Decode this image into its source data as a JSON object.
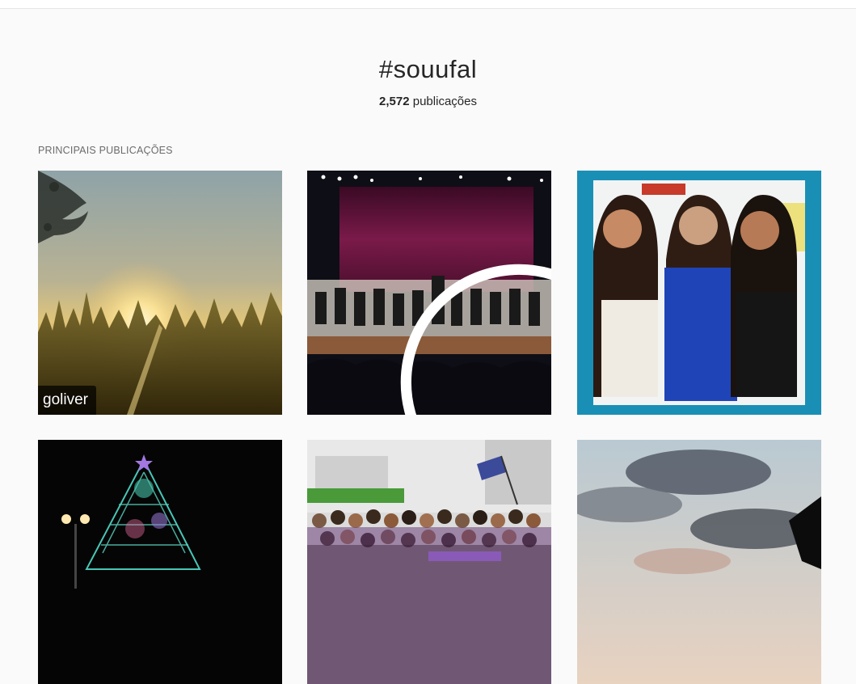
{
  "hashtag": {
    "title": "#souufal",
    "count": "2,572",
    "count_label": "publicações"
  },
  "section": {
    "label": "PRINCIPAIS PUBLICAÇÕES"
  },
  "posts": [
    {
      "scene": "sunset-field",
      "overlay_user": "goliver",
      "is_video": false
    },
    {
      "scene": "orchestra-stage",
      "overlay_user": "",
      "is_video": true
    },
    {
      "scene": "three-women-frame",
      "overlay_user": "",
      "is_video": false
    },
    {
      "scene": "christmas-tree-lights",
      "overlay_user": "",
      "is_video": false
    },
    {
      "scene": "crowd-group-photo",
      "overlay_user": "",
      "is_video": false
    },
    {
      "scene": "cloudy-sky",
      "overlay_user": "",
      "is_video": false
    }
  ],
  "colors": {
    "background": "#fafafa",
    "text": "#262626",
    "muted": "#6b6b6b"
  }
}
